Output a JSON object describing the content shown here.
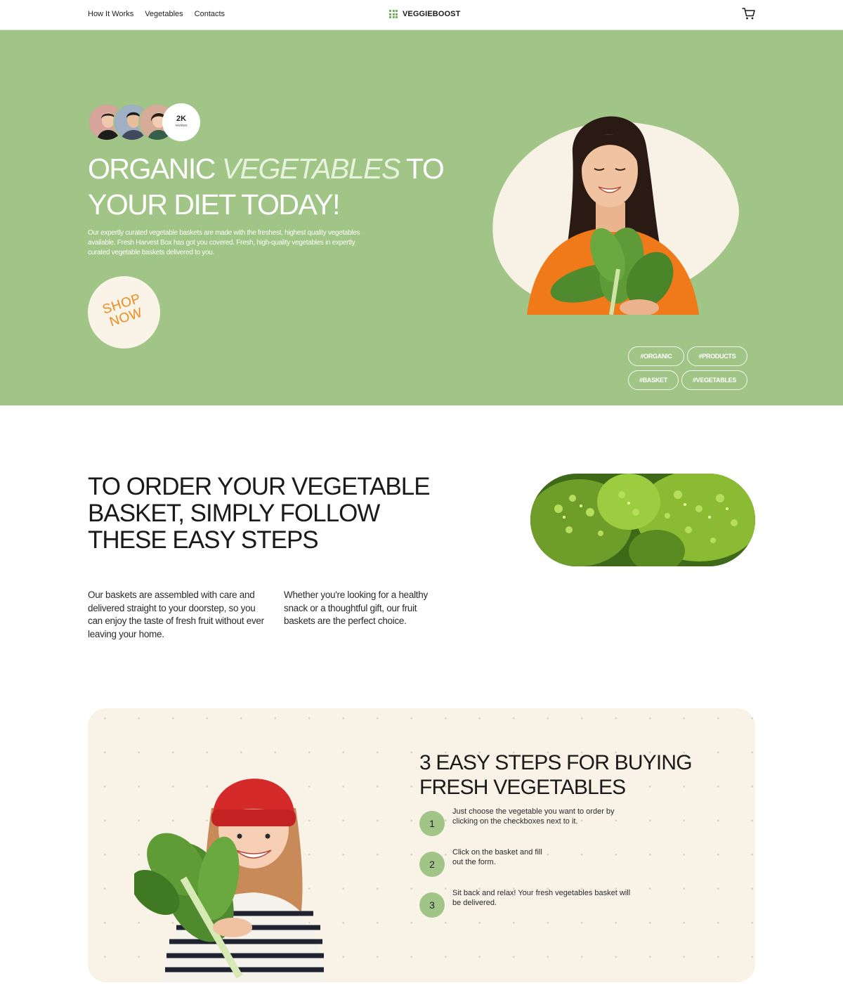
{
  "header": {
    "nav": [
      "How It Works",
      "Vegetables",
      "Contacts"
    ],
    "logo": "VEGGIEBOOST",
    "cart_icon": "cart-icon"
  },
  "hero": {
    "reviews_count": "2K",
    "reviews_label": "reviews",
    "title_part1": "ORGANIC ",
    "title_italic": "VEGETABLES",
    "title_part2": " TO YOUR DIET TODAY!",
    "description": "Our expertly curated vegetable baskets are made with the freshest, highest quality vegetables available. Fresh Harvest Box has got you covered. Fresh, high-quality vegetables in expertly curated vegetable baskets delivered to you.",
    "shop_button": "SHOP NOW",
    "tags": [
      "#ORGANIC",
      "#PRODUCTS",
      "#BASKET",
      "#VEGETABLES"
    ]
  },
  "steps_intro": {
    "title": "TO ORDER YOUR VEGETABLE BASKET, SIMPLY FOLLOW THESE EASY STEPS",
    "paragraph1": "Our baskets are assembled with care and delivered straight to your doorstep, so you can enjoy the taste of fresh fruit without ever leaving your home.",
    "paragraph2": "Whether you're looking for a healthy snack or a thoughtful gift, our fruit baskets are the perfect choice."
  },
  "easy_steps": {
    "title": "3 EASY STEPS FOR BUYING FRESH VEGETABLES",
    "steps": [
      {
        "num": "1",
        "text": "Just choose the vegetable you want to order by clicking on the checkboxes next to it."
      },
      {
        "num": "2",
        "text": "Click on the basket and fill out the form."
      },
      {
        "num": "3",
        "text": "Sit back and relax! Your fresh vegetables basket will be delivered."
      }
    ]
  },
  "colors": {
    "hero_green": "#a1c587",
    "cream": "#f8f2e7",
    "accent_orange": "#f08a1c"
  }
}
